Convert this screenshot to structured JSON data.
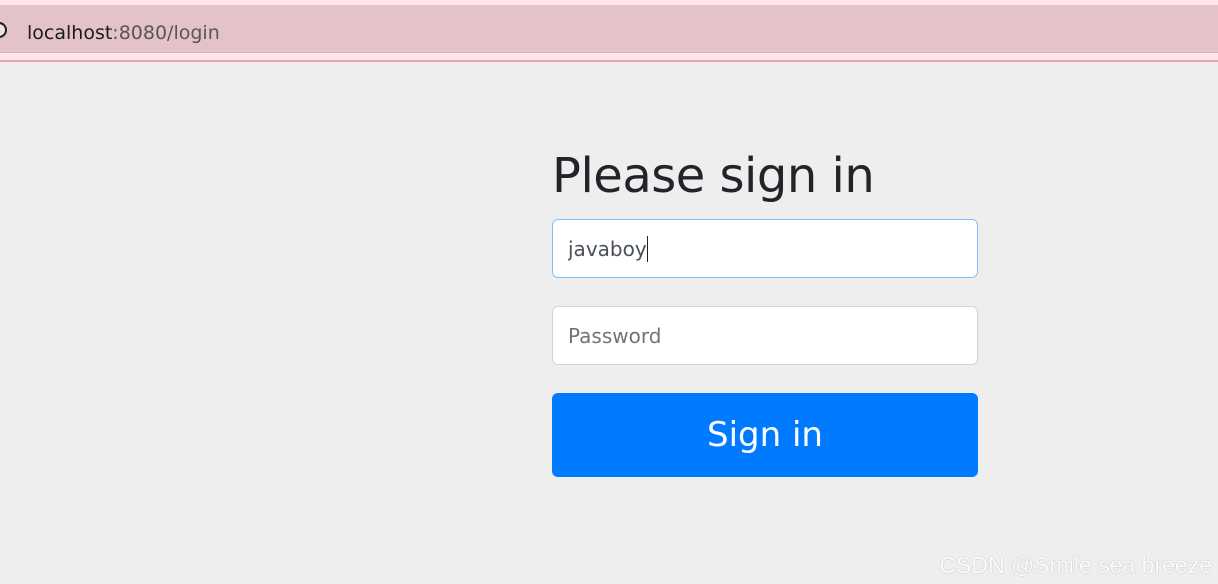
{
  "browser": {
    "url_host": "localhost",
    "url_rest": ":8080/login"
  },
  "form": {
    "heading": "Please sign in",
    "username_value": "javaboy",
    "password_placeholder": "Password",
    "submit_label": "Sign in"
  },
  "watermark": "CSDN @Smile sea breeze",
  "colors": {
    "background": "#eeeeee",
    "button": "#007bff",
    "focus_border": "#80bdff"
  }
}
